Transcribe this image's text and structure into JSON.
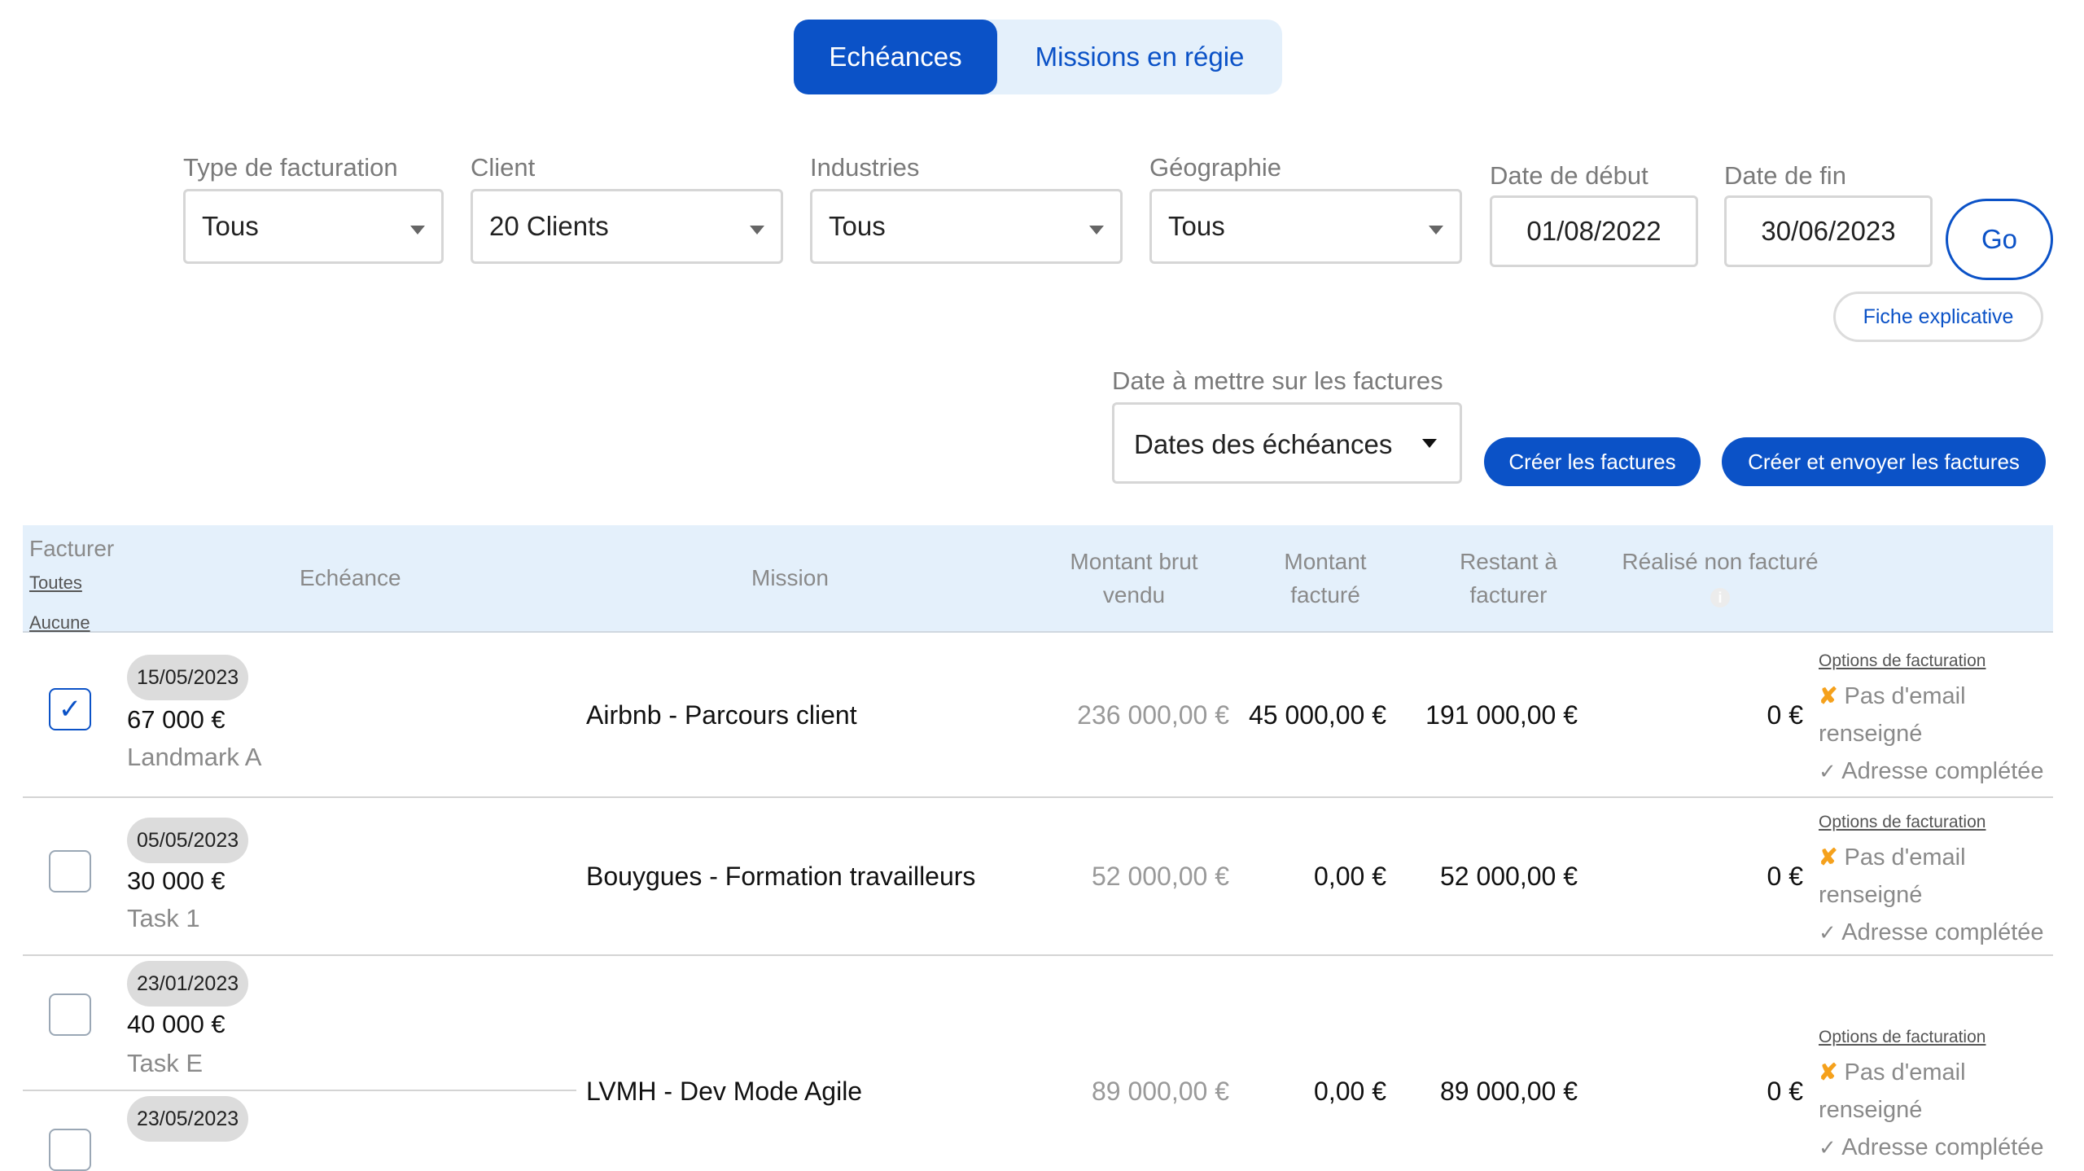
{
  "tabs": [
    {
      "label": "Echéances",
      "active": true
    },
    {
      "label": "Missions en régie",
      "active": false
    }
  ],
  "filters": {
    "type_facturation": {
      "label": "Type de facturation",
      "value": "Tous"
    },
    "client": {
      "label": "Client",
      "value": "20 Clients"
    },
    "industries": {
      "label": "Industries",
      "value": "Tous"
    },
    "geographie": {
      "label": "Géographie",
      "value": "Tous"
    },
    "date_debut": {
      "label": "Date de début",
      "value": "01/08/2022"
    },
    "date_fin": {
      "label": "Date de fin",
      "value": "30/06/2023"
    },
    "go_label": "Go",
    "fiche_label": "Fiche explicative"
  },
  "invoice_date": {
    "label": "Date à mettre sur les factures",
    "value": "Dates des échéances"
  },
  "actions": {
    "create_label": "Créer les factures",
    "create_send_label": "Créer et envoyer les factures"
  },
  "table": {
    "headers": {
      "facturer": "Facturer",
      "toutes": "Toutes",
      "aucune": "Aucune",
      "echeance": "Echéance",
      "mission": "Mission",
      "montant_brut_1": "Montant brut",
      "montant_brut_2": "vendu",
      "montant_facture_1": "Montant",
      "montant_facture_2": "facturé",
      "restant_1": "Restant à",
      "restant_2": "facturer",
      "realise": "Réalisé non facturé",
      "info_icon": "i"
    },
    "rows": [
      {
        "checked": true,
        "date": "15/05/2023",
        "amount": "67 000 €",
        "task": "Landmark A",
        "mission": "Airbnb - Parcours client",
        "brut": "236 000,00 €",
        "facture": "45 000,00 €",
        "restant": "191 000,00 €",
        "realise": "0 €",
        "options": "Options de facturation",
        "email_mark": "✘",
        "email_status_1": "Pas d'email",
        "email_status_2": "renseigné",
        "address_mark": "✓",
        "address_status": "Adresse complétée"
      },
      {
        "checked": false,
        "date": "05/05/2023",
        "amount": "30 000 €",
        "task": "Task 1",
        "mission": "Bouygues - Formation travailleurs",
        "brut": "52 000,00 €",
        "facture": "0,00 €",
        "restant": "52 000,00 €",
        "realise": "0 €",
        "options": "Options de facturation",
        "email_mark": "✘",
        "email_status_1": "Pas d'email",
        "email_status_2": "renseigné",
        "address_mark": "✓",
        "address_status": "Adresse complétée"
      },
      {
        "checked": false,
        "date": "23/01/2023",
        "amount": "40 000 €",
        "task": "Task E",
        "date2": "23/05/2023",
        "mission": "LVMH - Dev Mode Agile",
        "brut": "89 000,00 €",
        "facture": "0,00 €",
        "restant": "89 000,00 €",
        "realise": "0 €",
        "options": "Options de facturation",
        "email_mark": "✘",
        "email_status_1": "Pas d'email",
        "email_status_2": "renseigné",
        "address_mark": "✓",
        "address_status": "Adresse complétée"
      }
    ]
  },
  "colors": {
    "primary": "#0b52c7",
    "header_bg": "#e4f0fb",
    "warning": "#f5a11c"
  }
}
